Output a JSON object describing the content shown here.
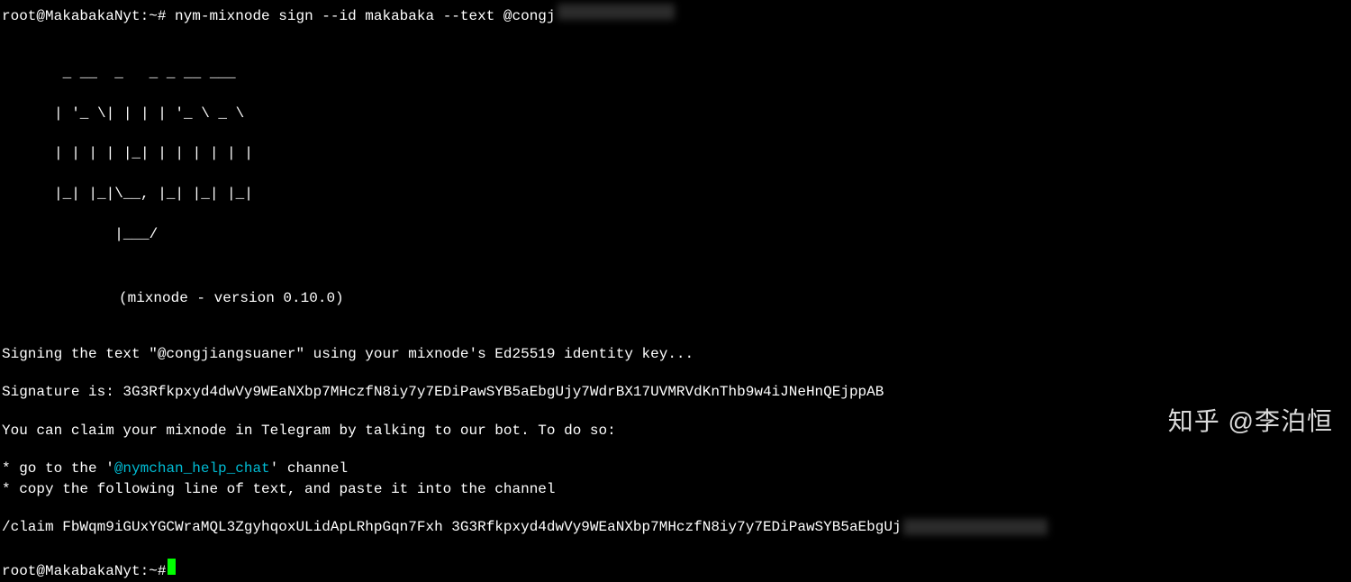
{
  "prompt1": {
    "user_host": "root@MakabakaNyt",
    "sep": ":",
    "path": "~#",
    "command": " nym-mixnode sign --id makabaka --text @congj"
  },
  "ascii": {
    "l1": " _ __  _   _ _ __ ___",
    "l2": "| '_ \\| | | | '_ \\ _ \\",
    "l3": "| | | | |_| | | | | | |",
    "l4": "|_| |_|\\__, |_| |_| |_|",
    "l5": "       |___/"
  },
  "version": "(mixnode - version 0.10.0)",
  "signing_text": "Signing the text \"@congjiangsuaner\" using your mixnode's Ed25519 identity key...",
  "signature_label": "Signature is: ",
  "signature_value": "3G3Rfkpxyd4dwVy9WEaNXbp7MHczfN8iy7y7EDiPawSYB5aEbgUjy7WdrBX17UVMRVdKnThb9w4iJNeHnQEjppAB",
  "claim_intro": "You can claim your mixnode in Telegram by talking to our bot. To do so:",
  "bullet1_prefix": "* go to the '",
  "bullet1_link": "@nymchan_help_chat",
  "bullet1_suffix": "' channel",
  "bullet2": "* copy the following line of text, and paste it into the channel",
  "claim_cmd": "/claim FbWqm9iGUxYGCWraMQL3ZgyhqoxULidApLRhpGqn7Fxh 3G3Rfkpxyd4dwVy9WEaNXbp7MHczfN8iy7y7EDiPawSYB5aEbgUj",
  "prompt2": {
    "user_host": "root@MakabakaNyt",
    "sep": ":",
    "path": "~#"
  },
  "watermark": "知乎 @李泊恒"
}
